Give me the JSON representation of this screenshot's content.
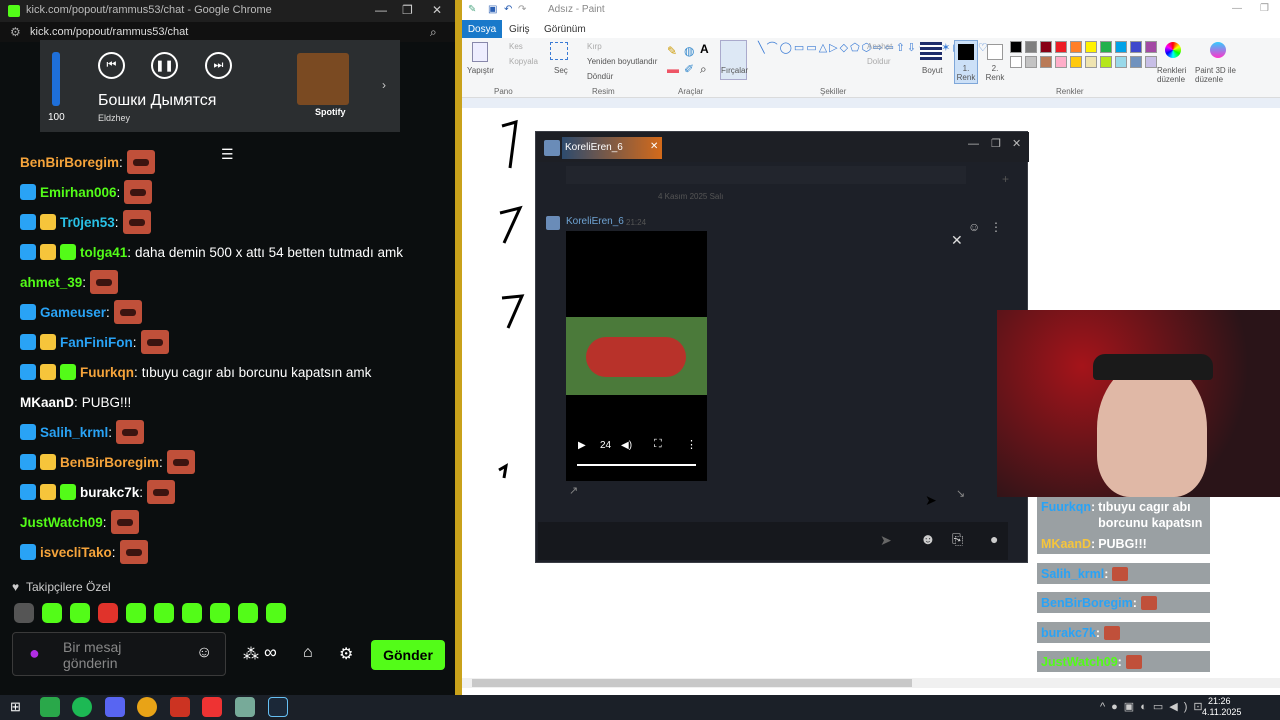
{
  "chrome": {
    "title": "kick.com/popout/rammus53/chat - Google Chrome",
    "url": "kick.com/popout/rammus53/chat",
    "window_controls": [
      "—",
      "❐",
      "✕"
    ]
  },
  "spotify": {
    "song": "Бошки Дымятся",
    "artist": "Eldzhey",
    "volume": "100",
    "volume_level": 1.0,
    "brand": "Spotify"
  },
  "chat": {
    "messages": [
      {
        "user": "BenBirBoregim",
        "color": "#f6a43b",
        "text": "",
        "emote": true
      },
      {
        "user": "Emirhan006",
        "color": "#53fc18",
        "text": "",
        "emote": true
      },
      {
        "user": "Tr0jen53",
        "color": "#29c1e6",
        "text": "",
        "emote": true
      },
      {
        "user": "tolga41",
        "color": "#53fc18",
        "text": "daha demin 500 x attı 54 betten tutmadı amk",
        "emote": false
      },
      {
        "user": "ahmet_39",
        "color": "#53fc18",
        "text": "",
        "emote": true
      },
      {
        "user": "Gameuser",
        "color": "#29a3f6",
        "text": "",
        "emote": true
      },
      {
        "user": "FanFiniFon",
        "color": "#29a3f6",
        "text": "",
        "emote": true
      },
      {
        "user": "Fuurkqn",
        "color": "#f6a43b",
        "text": "tıbuyu cagır abı borcunu kapatsın amk",
        "emote": false
      },
      {
        "user": "MKaanD",
        "color": "#ffffff",
        "text": "PUBG!!!",
        "emote": false
      },
      {
        "user": "Salih_krml",
        "color": "#29a3f6",
        "text": "",
        "emote": true
      },
      {
        "user": "BenBirBoregim",
        "color": "#f6a43b",
        "text": "",
        "emote": true
      },
      {
        "user": "burakc7k",
        "color": "#ffffff",
        "text": "",
        "emote": true
      },
      {
        "user": "JustWatch09",
        "color": "#53fc18",
        "text": "",
        "emote": true
      },
      {
        "user": "isvecliTako",
        "color": "#f6a43b",
        "text": "",
        "emote": true
      }
    ],
    "followers_only_label": "Takipçilere Özel",
    "input_placeholder": "Bir mesaj gönderin",
    "send_label": "Gönder"
  },
  "paint": {
    "title": "Adsız - Paint",
    "tabs": [
      "Dosya",
      "Giriş",
      "Görünüm"
    ],
    "clipboard": {
      "paste": "Yapıştır",
      "cut": "Kes",
      "copy": "Kopyala",
      "label": "Pano"
    },
    "image": {
      "select": "Seç",
      "crop": "Kırp",
      "resize": "Yeniden boyutlandır",
      "rotate": "Döndür",
      "label": "Resim"
    },
    "tools_label": "Araçlar",
    "brushes": "Fırçalar",
    "shapes": {
      "outline": "Anahat",
      "fill": "Doldur",
      "label": "Şekiller"
    },
    "size": "Boyut",
    "color1": "1. Renk",
    "color2": "2. Renk",
    "edit_colors": "Renkleri düzenle",
    "paint3d": "Paint 3D ile düzenle",
    "colors_label": "Renkler",
    "palette": [
      "#000000",
      "#7f7f7f",
      "#880015",
      "#ed1c24",
      "#ff7f27",
      "#fff200",
      "#22b14c",
      "#00a2e8",
      "#3f48cc",
      "#a349a4",
      "#ffffff",
      "#c3c3c3",
      "#b97a57",
      "#ffaec9",
      "#ffc90e",
      "#efe4b0",
      "#b5e61d",
      "#99d9ea",
      "#7092be",
      "#c8bfe7"
    ]
  },
  "steam": {
    "friend_name": "KoreliEren_6",
    "date_divider": "4 Kasım 2025 Salı",
    "time": "21:24",
    "video_time": "24"
  },
  "overlay_chat": [
    {
      "user": "Fuurkqn",
      "text": "tıbuyu cagır abı borcunu kapatsın amk"
    },
    {
      "user": "MKaanD",
      "text": "PUBG!!!"
    },
    {
      "user": "Salih_krml",
      "text": ""
    },
    {
      "user": "BenBirBoregim",
      "text": ""
    },
    {
      "user": "burakc7k",
      "text": ""
    },
    {
      "user": "JustWatch09",
      "text": ""
    }
  ],
  "taskbar": {
    "time": "21:26",
    "date": "4.11.2025"
  }
}
